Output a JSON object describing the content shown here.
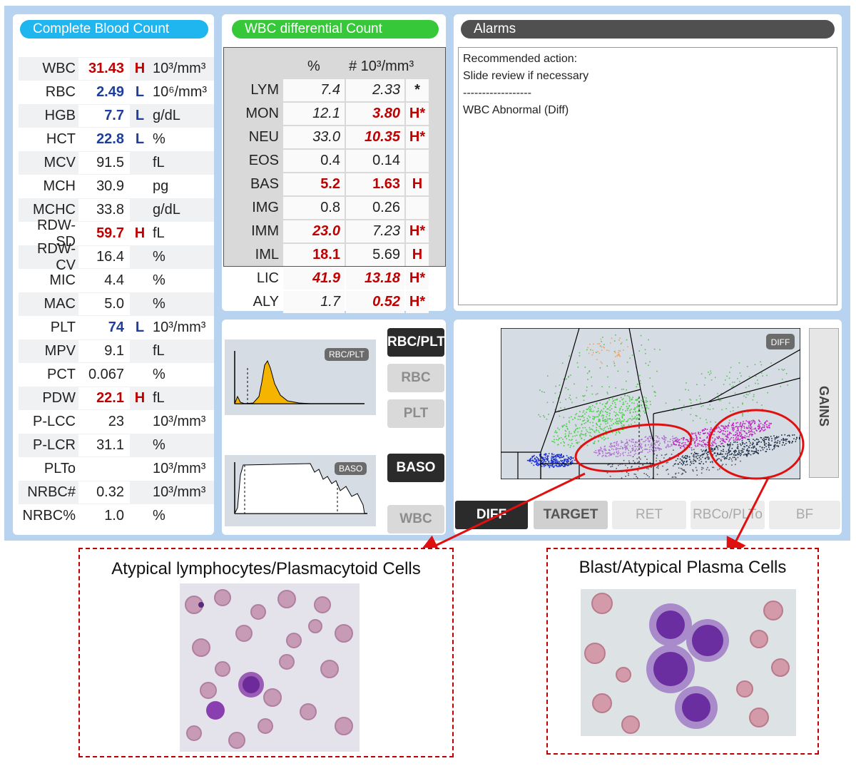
{
  "cbc": {
    "title": "Complete Blood Count",
    "rows": [
      {
        "name": "WBC",
        "value": "31.43",
        "flag": "H",
        "unit": "10³/mm³"
      },
      {
        "name": "RBC",
        "value": "2.49",
        "flag": "L",
        "unit": "10⁶/mm³"
      },
      {
        "name": "HGB",
        "value": "7.7",
        "flag": "L",
        "unit": "g/dL"
      },
      {
        "name": "HCT",
        "value": "22.8",
        "flag": "L",
        "unit": "%"
      },
      {
        "name": "MCV",
        "value": "91.5",
        "flag": "",
        "unit": "fL"
      },
      {
        "name": "MCH",
        "value": "30.9",
        "flag": "",
        "unit": "pg"
      },
      {
        "name": "MCHC",
        "value": "33.8",
        "flag": "",
        "unit": "g/dL"
      },
      {
        "name": "RDW-SD",
        "value": "59.7",
        "flag": "H",
        "unit": "fL"
      },
      {
        "name": "RDW-CV",
        "value": "16.4",
        "flag": "",
        "unit": "%"
      },
      {
        "name": "MIC",
        "value": "4.4",
        "flag": "",
        "unit": "%"
      },
      {
        "name": "MAC",
        "value": "5.0",
        "flag": "",
        "unit": "%"
      },
      {
        "name": "PLT",
        "value": "74",
        "flag": "L",
        "unit": "10³/mm³"
      },
      {
        "name": "MPV",
        "value": "9.1",
        "flag": "",
        "unit": "fL"
      },
      {
        "name": "PCT",
        "value": "0.067",
        "flag": "",
        "unit": "%"
      },
      {
        "name": "PDW",
        "value": "22.1",
        "flag": "H",
        "unit": "fL"
      },
      {
        "name": "P-LCC",
        "value": "23",
        "flag": "",
        "unit": "10³/mm³"
      },
      {
        "name": "P-LCR",
        "value": "31.1",
        "flag": "",
        "unit": "%"
      },
      {
        "name": "PLTo",
        "value": "",
        "flag": "",
        "unit": "10³/mm³"
      },
      {
        "name": "NRBC#",
        "value": "0.32",
        "flag": "",
        "unit": "10³/mm³"
      },
      {
        "name": "NRBC%",
        "value": "1.0",
        "flag": "",
        "unit": "%"
      }
    ]
  },
  "diff": {
    "title": "WBC differential Count",
    "col_pct": "%",
    "col_abs": "# 10³/mm³",
    "rows": [
      {
        "name": "LYM",
        "pct": "7.4",
        "abs": "2.33",
        "flag": "*",
        "pct_style": "normal-italic",
        "abs_style": "normal-italic"
      },
      {
        "name": "MON",
        "pct": "12.1",
        "abs": "3.80",
        "flag": "H*",
        "pct_style": "normal-italic",
        "abs_style": "hi-italic"
      },
      {
        "name": "NEU",
        "pct": "33.0",
        "abs": "10.35",
        "flag": "H*",
        "pct_style": "normal-italic",
        "abs_style": "hi-italic"
      },
      {
        "name": "EOS",
        "pct": "0.4",
        "abs": "0.14",
        "flag": "",
        "pct_style": "normal",
        "abs_style": "normal"
      },
      {
        "name": "BAS",
        "pct": "5.2",
        "abs": "1.63",
        "flag": "H",
        "pct_style": "hi",
        "abs_style": "hi"
      },
      {
        "name": "IMG",
        "pct": "0.8",
        "abs": "0.26",
        "flag": "",
        "pct_style": "normal",
        "abs_style": "normal"
      },
      {
        "name": "IMM",
        "pct": "23.0",
        "abs": "7.23",
        "flag": "H*",
        "pct_style": "hi-italic",
        "abs_style": "normal-italic"
      },
      {
        "name": "IML",
        "pct": "18.1",
        "abs": "5.69",
        "flag": "H",
        "pct_style": "hi",
        "abs_style": "normal"
      },
      {
        "name": "LIC",
        "pct": "41.9",
        "abs": "13.18",
        "flag": "H*",
        "pct_style": "hi-italic",
        "abs_style": "hi-italic"
      },
      {
        "name": "ALY",
        "pct": "1.7",
        "abs": "0.52",
        "flag": "H*",
        "pct_style": "normal-italic",
        "abs_style": "hi-italic"
      }
    ]
  },
  "alarms": {
    "title": "Alarms",
    "lines": [
      "Recommended action:",
      "Slide review if necessary",
      "------------------",
      "WBC Abnormal (Diff)"
    ]
  },
  "histograms": {
    "rbc_plt_badge": "RBC/PLT",
    "baso_badge": "BASO",
    "buttons": {
      "rbc_plt": "RBC/PLT",
      "rbc": "RBC",
      "plt": "PLT",
      "baso": "BASO",
      "wbc": "WBC"
    }
  },
  "scatter": {
    "badge": "DIFF",
    "gains": "GAINS",
    "modes": {
      "diff": "DIFF",
      "target": "TARGET",
      "ret": "RET",
      "rbco_plto": "RBCo/PLTo",
      "bf": "BF"
    }
  },
  "callouts": {
    "left_title": "Atypical lymphocytes/Plasmacytoid Cells",
    "right_title": "Blast/Atypical Plasma Cells"
  },
  "colors": {
    "cbc_pill": "#1fb6f0",
    "diff_pill": "#37c83a",
    "alarm_pill": "#505050",
    "flag_high": "#c00000",
    "flag_low": "#1f3e9c",
    "callout_border": "#c00000"
  }
}
